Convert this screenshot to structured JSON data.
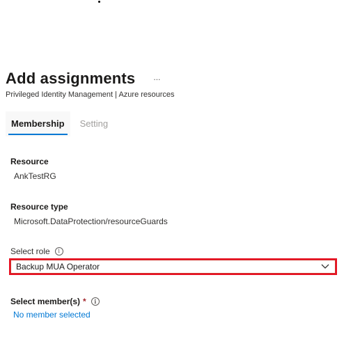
{
  "header": {
    "title": "Add assignments",
    "more_label": "...",
    "subtitle": "Privileged Identity Management | Azure resources"
  },
  "tabs": [
    {
      "label": "Membership",
      "active": true
    },
    {
      "label": "Setting",
      "active": false
    }
  ],
  "form": {
    "resource": {
      "label": "Resource",
      "value": "AnkTestRG"
    },
    "resource_type": {
      "label": "Resource type",
      "value": "Microsoft.DataProtection/resourceGuards"
    },
    "select_role": {
      "label": "Select role",
      "value": "Backup MUA Operator",
      "info_glyph": "i"
    },
    "select_members": {
      "label": "Select member(s)",
      "required_mark": "*",
      "info_glyph": "i",
      "link": "No member selected"
    }
  },
  "colors": {
    "accent": "#0078d4",
    "highlight_border": "#e81123",
    "required": "#a4262c"
  },
  "icons": {
    "more": "more-icon",
    "info": "info-icon",
    "chevron": "chevron-down-icon"
  }
}
